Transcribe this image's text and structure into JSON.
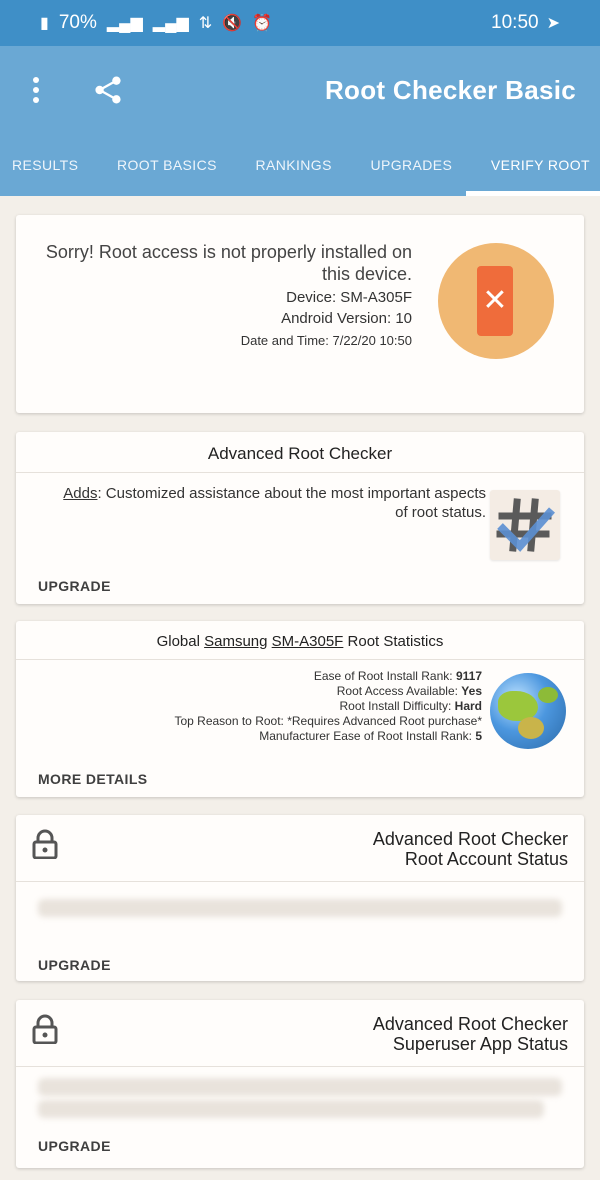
{
  "status_bar": {
    "time": "10:50",
    "battery": "70%"
  },
  "app_bar": {
    "title": "Root Checker Basic",
    "icons": [
      "more-vert-icon",
      "share-icon"
    ]
  },
  "tabs": [
    "VERIFY ROOT",
    "UPGRADES",
    "RANKINGS",
    "ROOT BASICS",
    "RESULTS"
  ],
  "verify_card": {
    "message": "Sorry! Root access is not properly installed on this device.",
    "device": "Device: SM-A305F",
    "android": "Android Version: 10",
    "datetime": "Date and Time: 7/22/20 10:50"
  },
  "advanced_card": {
    "title": "Advanced Root Checker",
    "adds_label": "Adds",
    "desc": ": Customized assistance about the most important aspects of root status.",
    "button": "UPGRADE"
  },
  "stats_card": {
    "title_prefix": "Global ",
    "title_brand": "Samsung",
    "title_model": "SM-A305F",
    "title_suffix": " Root Statistics",
    "ease_label": "Ease of Root Install Rank: ",
    "ease_value": "9117",
    "access_label": "Root Access Available: ",
    "access_value": "Yes",
    "difficulty_label": "Root Install Difficulty: ",
    "difficulty_value": "Hard",
    "reason": "Top Reason to Root: *Requires Advanced Root purchase*",
    "mfr_label": "Manufacturer Ease of Root Install Rank: ",
    "mfr_value": "5",
    "button": "MORE DETAILS"
  },
  "account_card": {
    "title_line1": "Advanced Root Checker",
    "title_line2": "Root Account Status",
    "button": "UPGRADE"
  },
  "superuser_card": {
    "title_line1": "Advanced Root Checker",
    "title_line2": "Superuser App Status",
    "button": "UPGRADE"
  }
}
